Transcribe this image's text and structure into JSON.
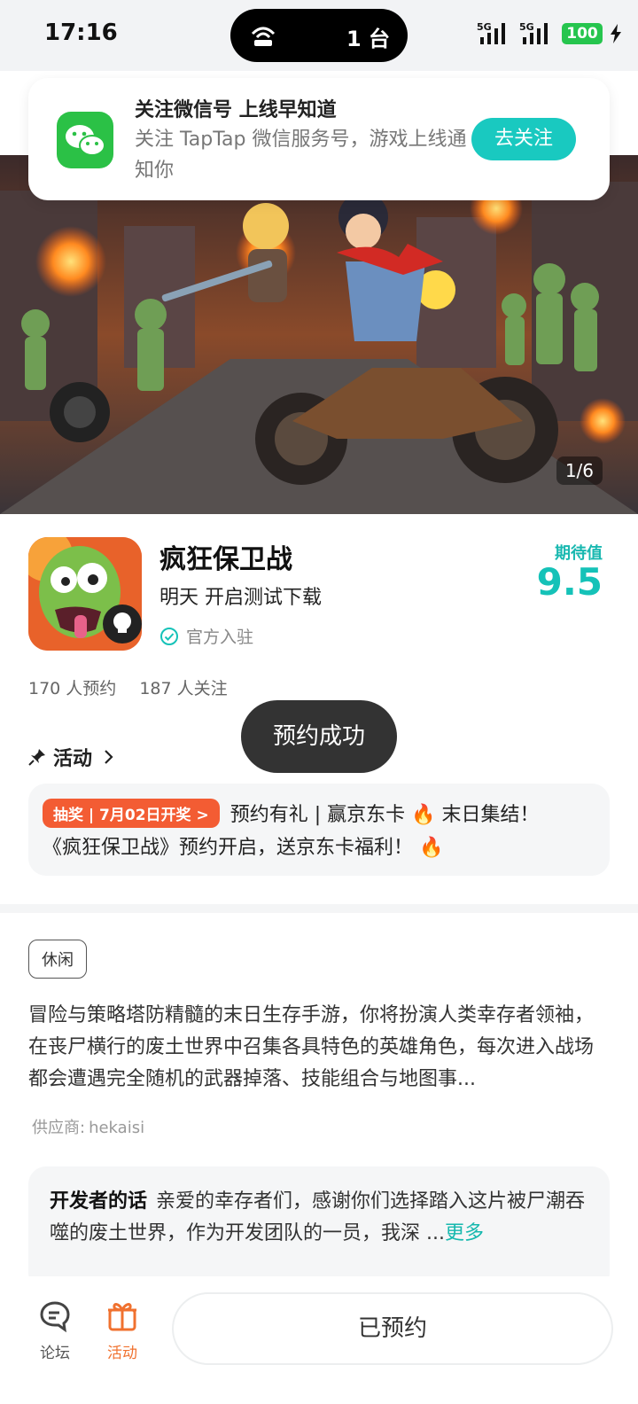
{
  "status_bar": {
    "time": "17:16",
    "island_count": "1 台",
    "network1": "5G",
    "network2": "5G",
    "battery": "100"
  },
  "follow_card": {
    "title": "关注微信号 上线早知道",
    "description": "关注 TapTap 微信服务号，游戏上线通知你",
    "button": "去关注"
  },
  "hero": {
    "pager": "1/6"
  },
  "game": {
    "title": "疯狂保卫战",
    "subtitle": "明天 开启测试下载",
    "official": "官方入驻",
    "expect_label": "期待值",
    "expect_value": "9.5",
    "reservations": "170 人预约",
    "followers": "187 人关注"
  },
  "activity": {
    "label": "活动",
    "badge": "抽奖 | 7月02日开奖 >",
    "line1": "预约有礼 | 赢京东卡 🔥 末日集结！",
    "line2": "《疯狂保卫战》预约开启，送京东卡福利！ 🔥"
  },
  "toast": "预约成功",
  "details": {
    "tag": "休闲",
    "description": "冒险与策略塔防精髓的末日生存手游，你将扮演人类幸存者领袖，在丧尸横行的废土世界中召集各具特色的英雄角色，每次进入战场都会遭遇完全随机的武器掉落、技能组合与地图事...",
    "supplier_label": "供应商:",
    "supplier": "hekaisi"
  },
  "developer": {
    "label": "开发者的话",
    "text": "亲爱的幸存者们，感谢你们选择踏入这片被尸潮吞噬的废土世界，作为开发团队的一员，我深 ...",
    "more": "更多"
  },
  "bottom": {
    "forum": "论坛",
    "activity": "活动",
    "reserved": "已预约"
  },
  "colors": {
    "accent": "#15c2b8",
    "orange": "#f0712f",
    "wechat": "#2bc146"
  }
}
